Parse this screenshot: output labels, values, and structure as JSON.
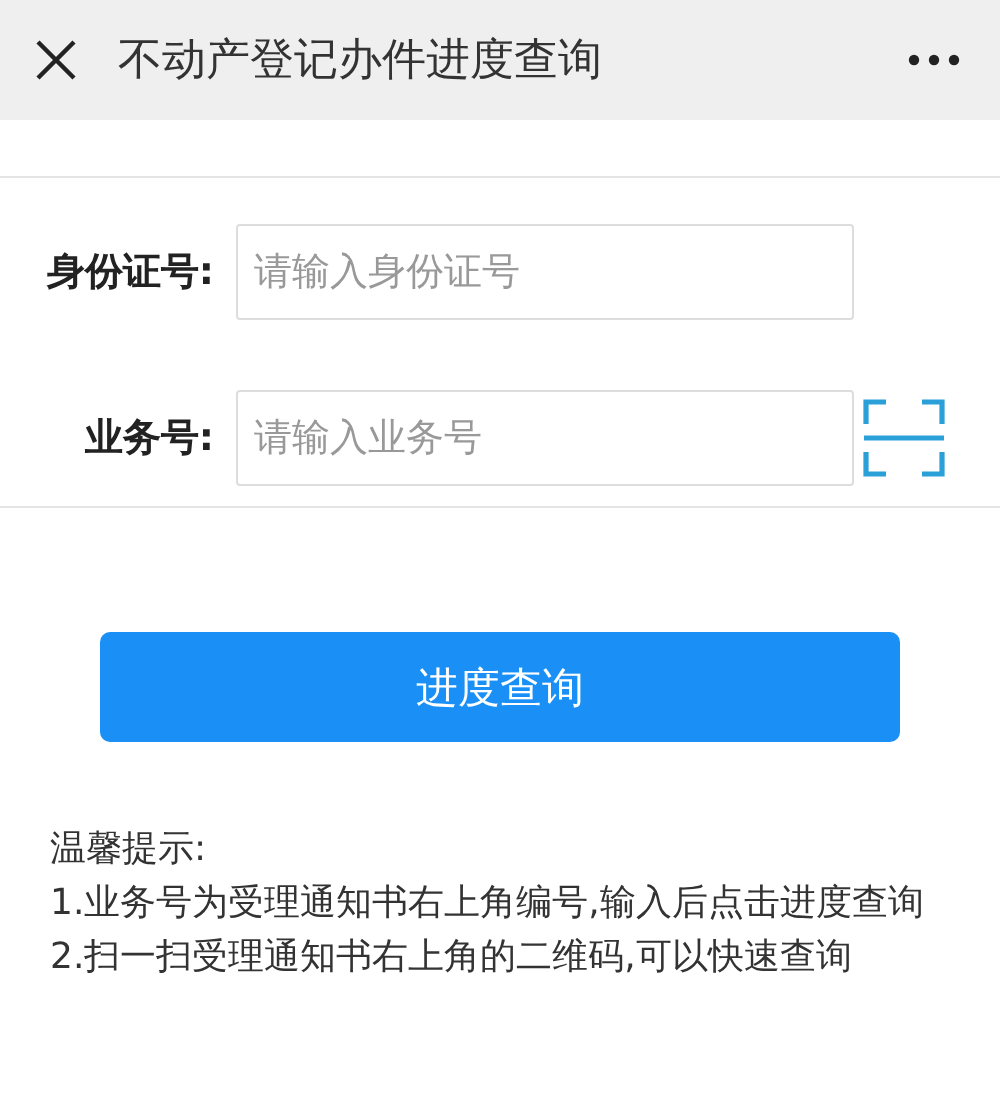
{
  "window": {
    "title": "不动产登记办件进度查询"
  },
  "fields": [
    {
      "label": "身份证号:",
      "placeholder": "请输入身份证号",
      "scan": false
    },
    {
      "label": "业务号:",
      "placeholder": "请输入业务号",
      "scan": true
    }
  ],
  "submit_button": "进度查询",
  "tips": {
    "title": "温馨提示:",
    "items": [
      "1.业务号为受理通知书右上角编号,输入后点击进度查询",
      "2.扫一扫受理通知书右上角的二维码,可以快速查询"
    ]
  }
}
